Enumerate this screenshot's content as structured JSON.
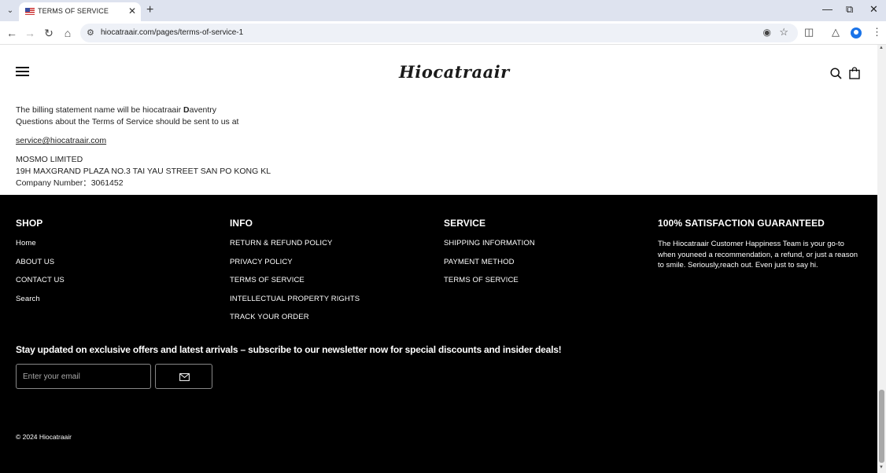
{
  "browser": {
    "tab_title": "TERMS OF SERVICE",
    "url": "hiocatraair.com/pages/terms-of-service-1",
    "tab_menu_glyph": "⌄",
    "newtab_glyph": "+",
    "close_glyph": "✕"
  },
  "site": {
    "logo": "Hiocatraair"
  },
  "content": {
    "billing_prefix": "The billing statement name will be hiocatraair ",
    "billing_bold": "D",
    "billing_suffix": "aventry",
    "questions": "Questions about the Terms of Service should be sent to us at",
    "email": "service@hiocatraair.com",
    "company": "MOSMO LIMITED",
    "address": "19H MAXGRAND PLAZA NO.3 TAI YAU STREET SAN PO KONG KL",
    "company_number": "Company Number：3061452"
  },
  "footer": {
    "shop": {
      "heading": "SHOP",
      "links": [
        "Home",
        "ABOUT US",
        "CONTACT US",
        "Search"
      ]
    },
    "info": {
      "heading": "INFO",
      "links": [
        "RETURN & REFUND POLICY",
        "PRIVACY POLICY",
        "TERMS OF SERVICE",
        "INTELLECTUAL PROPERTY RIGHTS",
        "TRACK YOUR ORDER"
      ]
    },
    "service": {
      "heading": "SERVICE",
      "links": [
        "SHIPPING INFORMATION",
        "PAYMENT METHOD",
        "TERMS OF SERVICE"
      ]
    },
    "guarantee": {
      "heading": "100% SATISFACTION GUARANTEED",
      "text": "The Hiocatraair Customer Happiness Team is your go-to when youneed a recommendation, a refund, or just a reason to smile. Seriously,reach out. Even just to say hi."
    },
    "newsletter": {
      "text": "Stay updated on exclusive offers and latest arrivals – subscribe to our newsletter now for special discounts and insider deals!",
      "placeholder": "Enter your email"
    },
    "copyright": "© 2024 Hiocatraair"
  }
}
